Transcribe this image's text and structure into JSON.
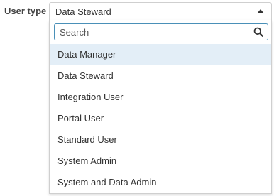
{
  "field": {
    "label": "User type",
    "selected_value": "Data Steward"
  },
  "dropdown": {
    "search_placeholder": "Search",
    "search_value": "",
    "highlighted_index": 0,
    "options": [
      {
        "label": "Data Manager"
      },
      {
        "label": "Data Steward"
      },
      {
        "label": "Integration User"
      },
      {
        "label": "Portal User"
      },
      {
        "label": "Standard User"
      },
      {
        "label": "System Admin"
      },
      {
        "label": "System and Data Admin"
      }
    ]
  },
  "icons": {
    "caret": "caret-up-icon",
    "search": "search-icon"
  },
  "colors": {
    "highlight": "#e3eef7",
    "search_border": "#4a90b8"
  }
}
